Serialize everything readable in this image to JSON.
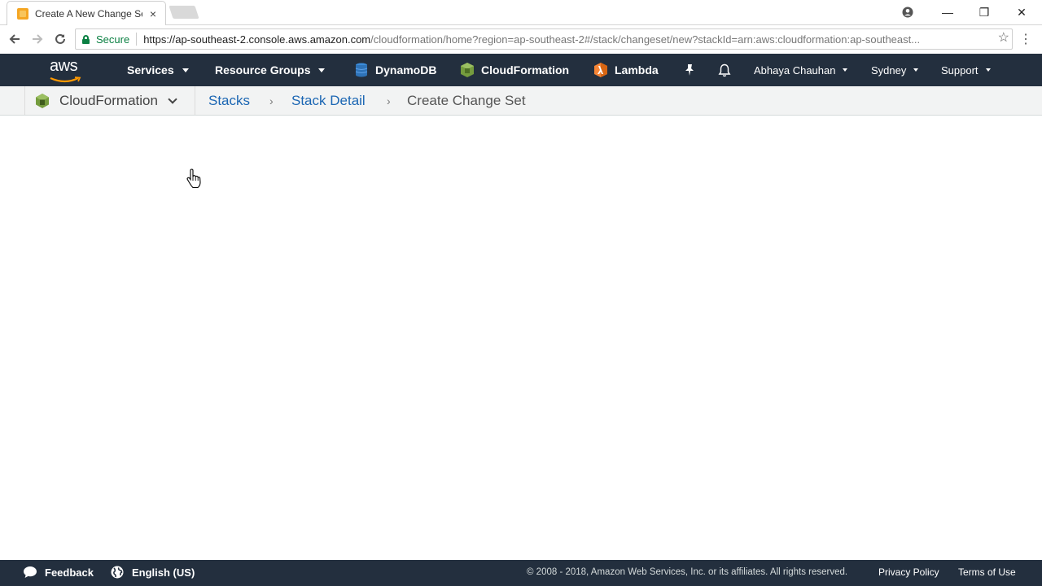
{
  "browser": {
    "tab_title": "Create A New Change Se",
    "tab_close": "×",
    "window_controls": {
      "minimize": "—",
      "restore": "❐",
      "close": "✕"
    },
    "secure_label": "Secure",
    "url_host": "https://ap-southeast-2.console.aws.amazon.com",
    "url_rest": "/cloudformation/home?region=ap-southeast-2#/stack/changeset/new?stackId=arn:aws:cloudformation:ap-southeast...",
    "icons": [
      "back-icon",
      "forward-icon",
      "reload-icon",
      "lock-icon",
      "star-icon",
      "menu-icon",
      "profile-icon"
    ]
  },
  "aws_nav": {
    "logo_text": "aws",
    "services_label": "Services",
    "resource_groups_label": "Resource Groups",
    "shortcuts": [
      {
        "label": "DynamoDB",
        "color": "#2e73b8"
      },
      {
        "label": "CloudFormation",
        "color": "#759c3e"
      },
      {
        "label": "Lambda",
        "color": "#f58536"
      }
    ],
    "user_label": "Abhaya Chauhan",
    "region_label": "Sydney",
    "support_label": "Support"
  },
  "service_bar": {
    "service_name": "CloudFormation",
    "breadcrumbs": [
      {
        "label": "Stacks"
      },
      {
        "label": "Stack Detail"
      },
      {
        "label": "Create Change Set"
      }
    ],
    "separator": "›"
  },
  "footer": {
    "feedback_label": "Feedback",
    "language_label": "English (US)",
    "copyright": "© 2008 - 2018, Amazon Web Services, Inc. or its affiliates. All rights reserved.",
    "privacy_label": "Privacy Policy",
    "terms_label": "Terms of Use"
  },
  "colors": {
    "nav_bg": "#232f3e",
    "link": "#1b66b3",
    "secure_green": "#0b8043"
  }
}
